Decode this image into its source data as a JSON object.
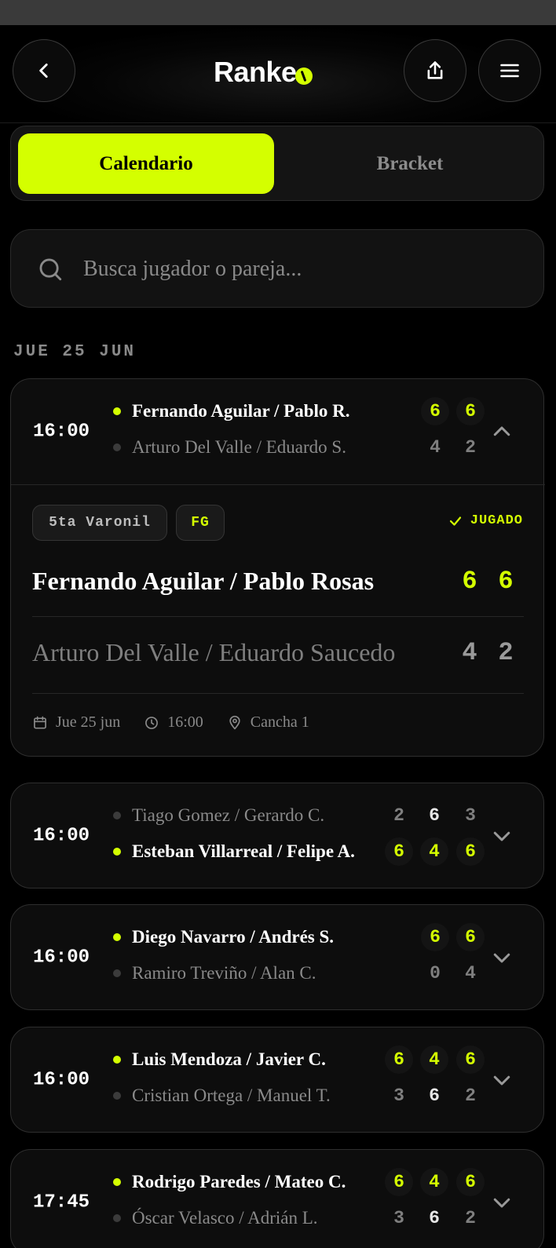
{
  "app": {
    "logo": "Ranke",
    "logo_ball_icon": "ball-icon"
  },
  "colors": {
    "accent": "#d4ff00",
    "background": "#000000",
    "card": "#0d0d0d",
    "muted": "#8a8a8a"
  },
  "tabs": [
    {
      "label": "Calendario",
      "active": true
    },
    {
      "label": "Bracket",
      "active": false
    }
  ],
  "search": {
    "placeholder": "Busca jugador o pareja..."
  },
  "day": {
    "label": "JUE 25 JUN"
  },
  "matches": [
    {
      "time": "16:00",
      "expanded": true,
      "top": {
        "name": "Fernando Aguilar / Pablo R.",
        "winner": true,
        "sets": [
          "6",
          "6"
        ]
      },
      "bottom": {
        "name": "Arturo Del Valle / Eduardo S.",
        "winner": false,
        "sets": [
          "4",
          "2"
        ]
      },
      "detail": {
        "category": "5ta Varonil",
        "tag": "FG",
        "status": "JUGADO",
        "top_full": "Fernando Aguilar / Pablo Rosas",
        "bottom_full": "Arturo Del Valle / Eduardo Saucedo",
        "date": "Jue 25 jun",
        "time": "16:00",
        "court": "Cancha 1"
      }
    },
    {
      "time": "16:00",
      "expanded": false,
      "top": {
        "name": "Tiago Gomez / Gerardo C.",
        "winner": false,
        "sets": [
          "2",
          "6",
          "3"
        ]
      },
      "bottom": {
        "name": "Esteban Villarreal / Felipe A.",
        "winner": true,
        "sets": [
          "6",
          "4",
          "6"
        ]
      }
    },
    {
      "time": "16:00",
      "expanded": false,
      "top": {
        "name": "Diego Navarro / Andrés S.",
        "winner": true,
        "sets": [
          "6",
          "6"
        ]
      },
      "bottom": {
        "name": "Ramiro Treviño / Alan C.",
        "winner": false,
        "sets": [
          "0",
          "4"
        ]
      }
    },
    {
      "time": "16:00",
      "expanded": false,
      "top": {
        "name": "Luis Mendoza / Javier C.",
        "winner": true,
        "sets": [
          "6",
          "4",
          "6"
        ]
      },
      "bottom": {
        "name": "Cristian Ortega / Manuel T.",
        "winner": false,
        "sets": [
          "3",
          "6",
          "2"
        ]
      }
    },
    {
      "time": "17:45",
      "expanded": false,
      "top": {
        "name": "Rodrigo Paredes / Mateo C.",
        "winner": true,
        "sets": [
          "6",
          "4",
          "6"
        ]
      },
      "bottom": {
        "name": "Óscar Velasco / Adrián L.",
        "winner": false,
        "sets": [
          "3",
          "6",
          "2"
        ]
      }
    }
  ]
}
